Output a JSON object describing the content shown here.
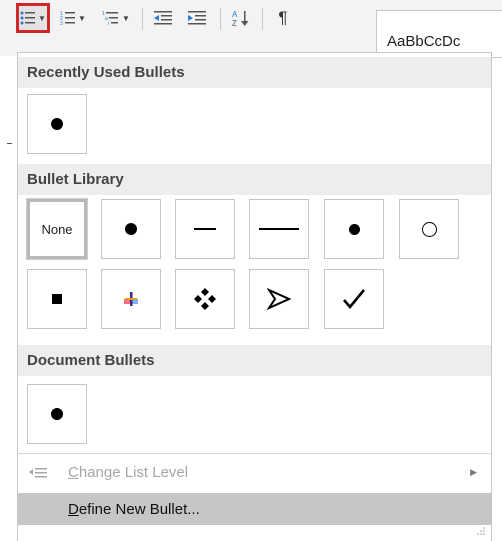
{
  "ribbon": {
    "styles_preview_text": "AaBbCcDc"
  },
  "gallery": {
    "sections": {
      "recent": "Recently Used Bullets",
      "library": "Bullet Library",
      "document": "Document Bullets"
    },
    "library_none_label": "None",
    "library_items": [
      "None",
      "filled-circle",
      "short-dash",
      "long-dash",
      "small-filled-circle",
      "hollow-circle",
      "filled-square",
      "colored-cross",
      "four-diamond",
      "arrowhead",
      "checkmark"
    ]
  },
  "menu": {
    "change_list_level": {
      "label_underlined": "C",
      "label_rest": "hange List Level"
    },
    "define_new_bullet": {
      "label_underlined": "D",
      "label_rest": "efine New Bullet..."
    }
  },
  "colors": {
    "highlight_border": "#d0282a",
    "section_header_bg": "#ededed",
    "active_item_bg": "#c6c6c6"
  }
}
